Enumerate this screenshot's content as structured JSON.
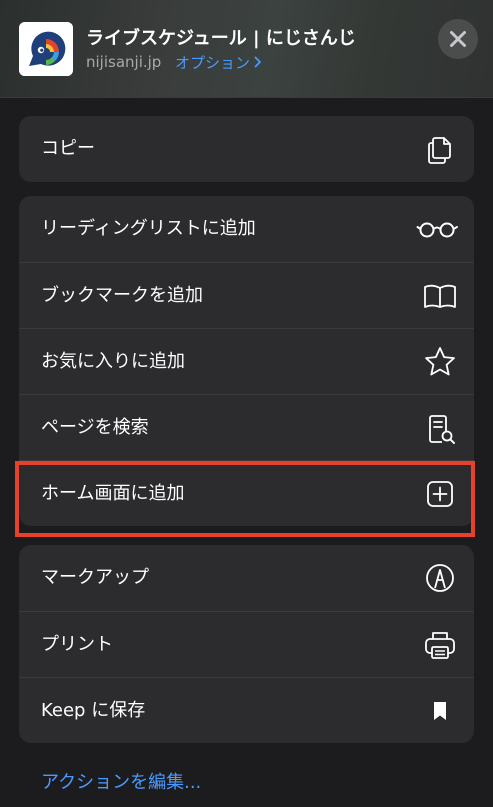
{
  "header": {
    "title": "ライブスケジュール | にじさんじ",
    "domain": "nijisanji.jp",
    "options_label": "オプション",
    "options_chevron": ">",
    "app_icon": "nijisanji-logo-icon",
    "close_icon": "close-icon"
  },
  "groups": [
    {
      "items": [
        {
          "label": "コピー",
          "icon": "copy-icon"
        }
      ]
    },
    {
      "items": [
        {
          "label": "リーディングリストに追加",
          "icon": "glasses-icon"
        },
        {
          "label": "ブックマークを追加",
          "icon": "book-icon"
        },
        {
          "label": "お気に入りに追加",
          "icon": "star-icon"
        },
        {
          "label": "ページを検索",
          "icon": "find-in-page-icon"
        },
        {
          "label": "ホーム画面に追加",
          "icon": "add-square-icon",
          "highlighted": true
        }
      ]
    },
    {
      "items": [
        {
          "label": "マークアップ",
          "icon": "markup-pen-icon"
        },
        {
          "label": "プリント",
          "icon": "printer-icon"
        },
        {
          "label": "Keep に保存",
          "icon": "bookmark-filled-icon"
        }
      ]
    }
  ],
  "footer": {
    "edit_actions_label": "アクションを編集..."
  },
  "colors": {
    "background": "#1c1c1e",
    "group_background": "#2c2c2e",
    "accent_link": "#4a9bff",
    "highlight_border": "#e8412b"
  }
}
